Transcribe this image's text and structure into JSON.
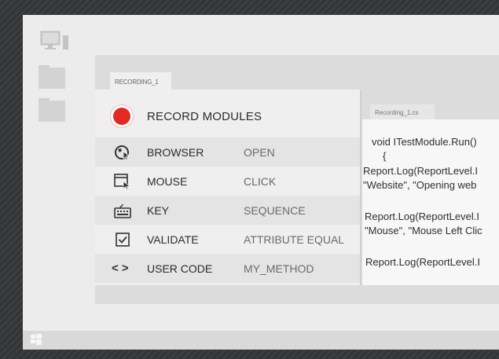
{
  "app": {
    "tab_label": "RECORDING_1",
    "record_title": "RECORD MODULES"
  },
  "modules": [
    {
      "name": "BROWSER",
      "action": "OPEN",
      "icon": "globe-cursor-icon"
    },
    {
      "name": "MOUSE",
      "action": "CLICK",
      "icon": "window-cursor-icon"
    },
    {
      "name": "KEY",
      "action": "SEQUENCE",
      "icon": "keyboard-icon"
    },
    {
      "name": "VALIDATE",
      "action": "ATTRIBUTE EQUAL",
      "icon": "checkbox-icon"
    },
    {
      "name": "USER CODE",
      "action": "MY_METHOD",
      "icon": "code-brackets-icon"
    }
  ],
  "code": {
    "tab_label": "Recording_1.cs",
    "lines": [
      "void ITestModule.Run()",
      "{",
      "Report.Log(ReportLevel.I",
      "\"Website\", \"Opening web",
      "Report.Log(ReportLevel.I",
      "\"Mouse\", \"Mouse Left Clic",
      "Report.Log(ReportLevel.I"
    ]
  },
  "user_code_glyph": "< >",
  "colors": {
    "record_red": "#e32a22",
    "screen_bg": "#ececec",
    "panel_bg": "#efefef"
  }
}
